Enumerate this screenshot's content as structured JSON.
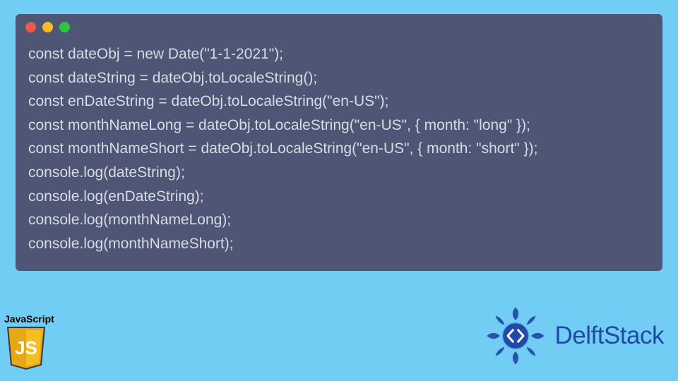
{
  "code": {
    "lines": [
      "const dateObj = new Date(\"1-1-2021\");",
      "const dateString = dateObj.toLocaleString();",
      "const enDateString = dateObj.toLocaleString(\"en-US\");",
      "const monthNameLong = dateObj.toLocaleString(\"en-US\", { month: \"long\" });",
      "const monthNameShort = dateObj.toLocaleString(\"en-US\", { month: \"short\" });",
      "console.log(dateString);",
      "console.log(enDateString);",
      "console.log(monthNameLong);",
      "console.log(monthNameShort);"
    ]
  },
  "jsBadge": {
    "label": "JavaScript",
    "glyph": "JS"
  },
  "brand": {
    "name": "DelftStack"
  },
  "colors": {
    "pageBg": "#72cdf4",
    "windowBg": "#4f5574",
    "codeText": "#d7dbe6",
    "brandBlue": "#1f4aa8",
    "jsYellow": "#f5be22"
  }
}
